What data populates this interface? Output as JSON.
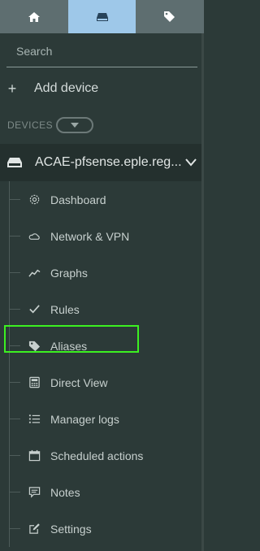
{
  "colors": {
    "sidebar_bg": "#2c3a38",
    "tab_bg": "#5e6e70",
    "tab_active_bg": "#9ec8e9",
    "device_row_bg": "#24302e",
    "highlight": "#3cf021"
  },
  "tabs": [
    {
      "icon": "home-icon",
      "active": false
    },
    {
      "icon": "devices-icon",
      "active": true
    },
    {
      "icon": "tags-icon",
      "active": false
    }
  ],
  "search": {
    "placeholder": "Search"
  },
  "add_device": {
    "label": "Add device"
  },
  "devices_header": {
    "label": "DEVICES"
  },
  "device": {
    "name": "ACAE-pfsense.eple.reg..."
  },
  "menu": [
    {
      "label": "Dashboard",
      "icon": "gear-icon"
    },
    {
      "label": "Network & VPN",
      "icon": "cloud-icon"
    },
    {
      "label": "Graphs",
      "icon": "line-chart-icon"
    },
    {
      "label": "Rules",
      "icon": "check-icon"
    },
    {
      "label": "Aliases",
      "icon": "tag-icon",
      "highlighted": true
    },
    {
      "label": "Direct View",
      "icon": "calculator-icon"
    },
    {
      "label": "Manager logs",
      "icon": "list-icon"
    },
    {
      "label": "Scheduled actions",
      "icon": "calendar-icon"
    },
    {
      "label": "Notes",
      "icon": "comment-icon"
    },
    {
      "label": "Settings",
      "icon": "edit-icon"
    }
  ]
}
